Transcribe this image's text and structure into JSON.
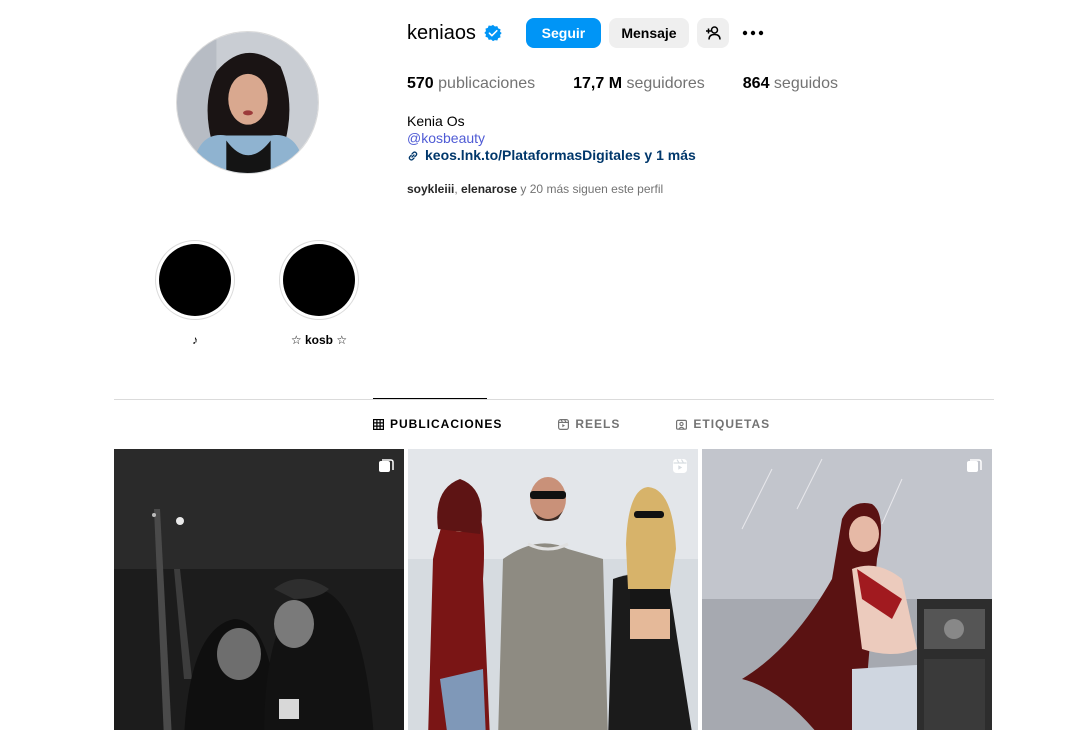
{
  "profile": {
    "username": "keniaos",
    "follow_label": "Seguir",
    "message_label": "Mensaje",
    "stats": {
      "posts_count": "570",
      "posts_label": "publicaciones",
      "followers_count": "17,7 M",
      "followers_label": "seguidores",
      "following_count": "864",
      "following_label": "seguidos"
    },
    "full_name": "Kenia Os",
    "handle": "@kosbeauty",
    "link": "keos.lnk.to/PlataformasDigitales y 1 más",
    "followed_by": {
      "user1": "soykleiii",
      "user2": "elenarose",
      "suffix": " y 20 más siguen este perfil"
    }
  },
  "highlights": [
    {
      "label": "♪"
    },
    {
      "label": "☆ kosb ☆"
    }
  ],
  "tabs": [
    {
      "label": "PUBLICACIONES",
      "icon": "grid-icon",
      "active": true
    },
    {
      "label": "REELS",
      "icon": "reels-icon",
      "active": false
    },
    {
      "label": "ETIQUETAS",
      "icon": "tagged-icon",
      "active": false
    }
  ],
  "posts": [
    {
      "type": "carousel",
      "icon": "carousel-icon"
    },
    {
      "type": "reel",
      "icon": "reel-icon"
    },
    {
      "type": "carousel",
      "icon": "carousel-icon"
    }
  ],
  "colors": {
    "accent": "#0095f6",
    "verified": "#0095f6",
    "link": "#00376b",
    "handle": "#4f5bd5"
  }
}
